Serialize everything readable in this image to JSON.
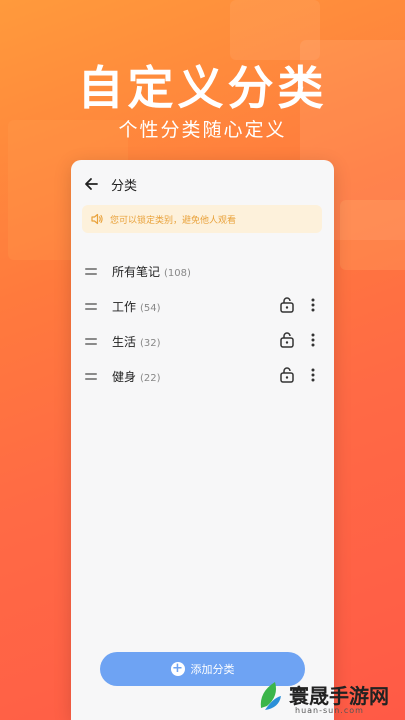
{
  "hero": {
    "title": "自定义分类",
    "subtitle": "个性分类随心定义"
  },
  "screen": {
    "title": "分类",
    "notice": "您可以锁定类别，避免他人观看",
    "categories": [
      {
        "name": "所有笔记",
        "count": "(108)",
        "lockable": false
      },
      {
        "name": "工作",
        "count": "(54)",
        "lockable": true
      },
      {
        "name": "生活",
        "count": "(32)",
        "lockable": true
      },
      {
        "name": "健身",
        "count": "(22)",
        "lockable": true
      }
    ],
    "add_button_label": "添加分类",
    "icons": [
      "back-arrow-icon",
      "speaker-icon",
      "drag-handle-icon",
      "unlock-icon",
      "more-vertical-icon",
      "plus-icon"
    ]
  },
  "colors": {
    "background_start": "#ff9a3c",
    "background_end": "#ff5a46",
    "notice_bg": "#fdf1db",
    "notice_text": "#e9a23b",
    "button": "#6ea3f3"
  },
  "watermark": {
    "name": "寰晟手游网",
    "url": "huan-sun.com"
  }
}
